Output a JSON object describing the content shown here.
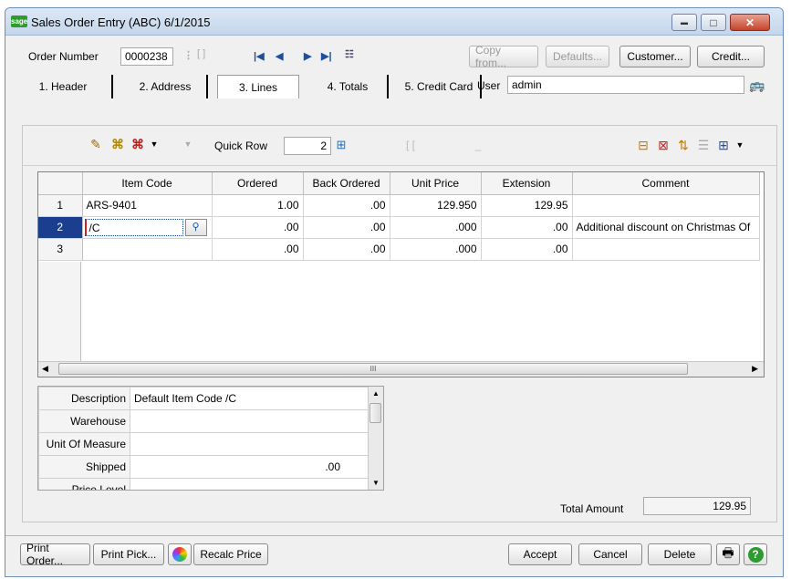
{
  "window": {
    "title": "Sales Order Entry (ABC) 6/1/2015",
    "minimize_glyph": "▬",
    "maximize_glyph": "□",
    "close_glyph": "✕",
    "logo_text": "sage"
  },
  "header": {
    "order_number_label": "Order Number",
    "order_number_value": "0000238",
    "copy_from_label": "Copy from...",
    "defaults_label": "Defaults...",
    "customer_label": "Customer...",
    "credit_label": "Credit..."
  },
  "tabs": [
    {
      "label": "1. Header"
    },
    {
      "label": "2. Address"
    },
    {
      "label": "3. Lines"
    },
    {
      "label": "4. Totals"
    },
    {
      "label": "5. Credit Card"
    }
  ],
  "user": {
    "label": "User",
    "value": "admin"
  },
  "lines_toolbar": {
    "quick_row_label": "Quick Row",
    "quick_row_value": "2"
  },
  "grid": {
    "columns": [
      "",
      "Item Code",
      "Ordered",
      "Back Ordered",
      "Unit Price",
      "Extension",
      "Comment"
    ],
    "rows": [
      {
        "num": "1",
        "item": "ARS-9401",
        "ordered": "1.00",
        "back": ".00",
        "price": "129.950",
        "ext": "129.95",
        "comment": ""
      },
      {
        "num": "2",
        "item": "/C",
        "ordered": ".00",
        "back": ".00",
        "price": ".000",
        "ext": ".00",
        "comment": "Additional discount on Christmas Of"
      },
      {
        "num": "3",
        "item": "",
        "ordered": ".00",
        "back": ".00",
        "price": ".000",
        "ext": ".00",
        "comment": ""
      }
    ],
    "scroll_glyph": "III"
  },
  "detail": {
    "rows": [
      {
        "label": "Description",
        "value": "Default Item Code /C"
      },
      {
        "label": "Warehouse",
        "value": ""
      },
      {
        "label": "Unit Of Measure",
        "value": ""
      },
      {
        "label": "Shipped",
        "value": ".00"
      },
      {
        "label": "Price Level",
        "value": ""
      }
    ]
  },
  "totals": {
    "label": "Total Amount",
    "value": "129.95"
  },
  "footer": {
    "print_order": "Print Order...",
    "print_pick": "Print Pick...",
    "recalc_price": "Recalc Price",
    "accept": "Accept",
    "cancel": "Cancel",
    "delete": "Delete"
  },
  "colors": {
    "accent": "#1a3f8f",
    "title_bar": "#c4d6ec",
    "close": "#c5442c",
    "sage_green": "#2e9b2e"
  }
}
